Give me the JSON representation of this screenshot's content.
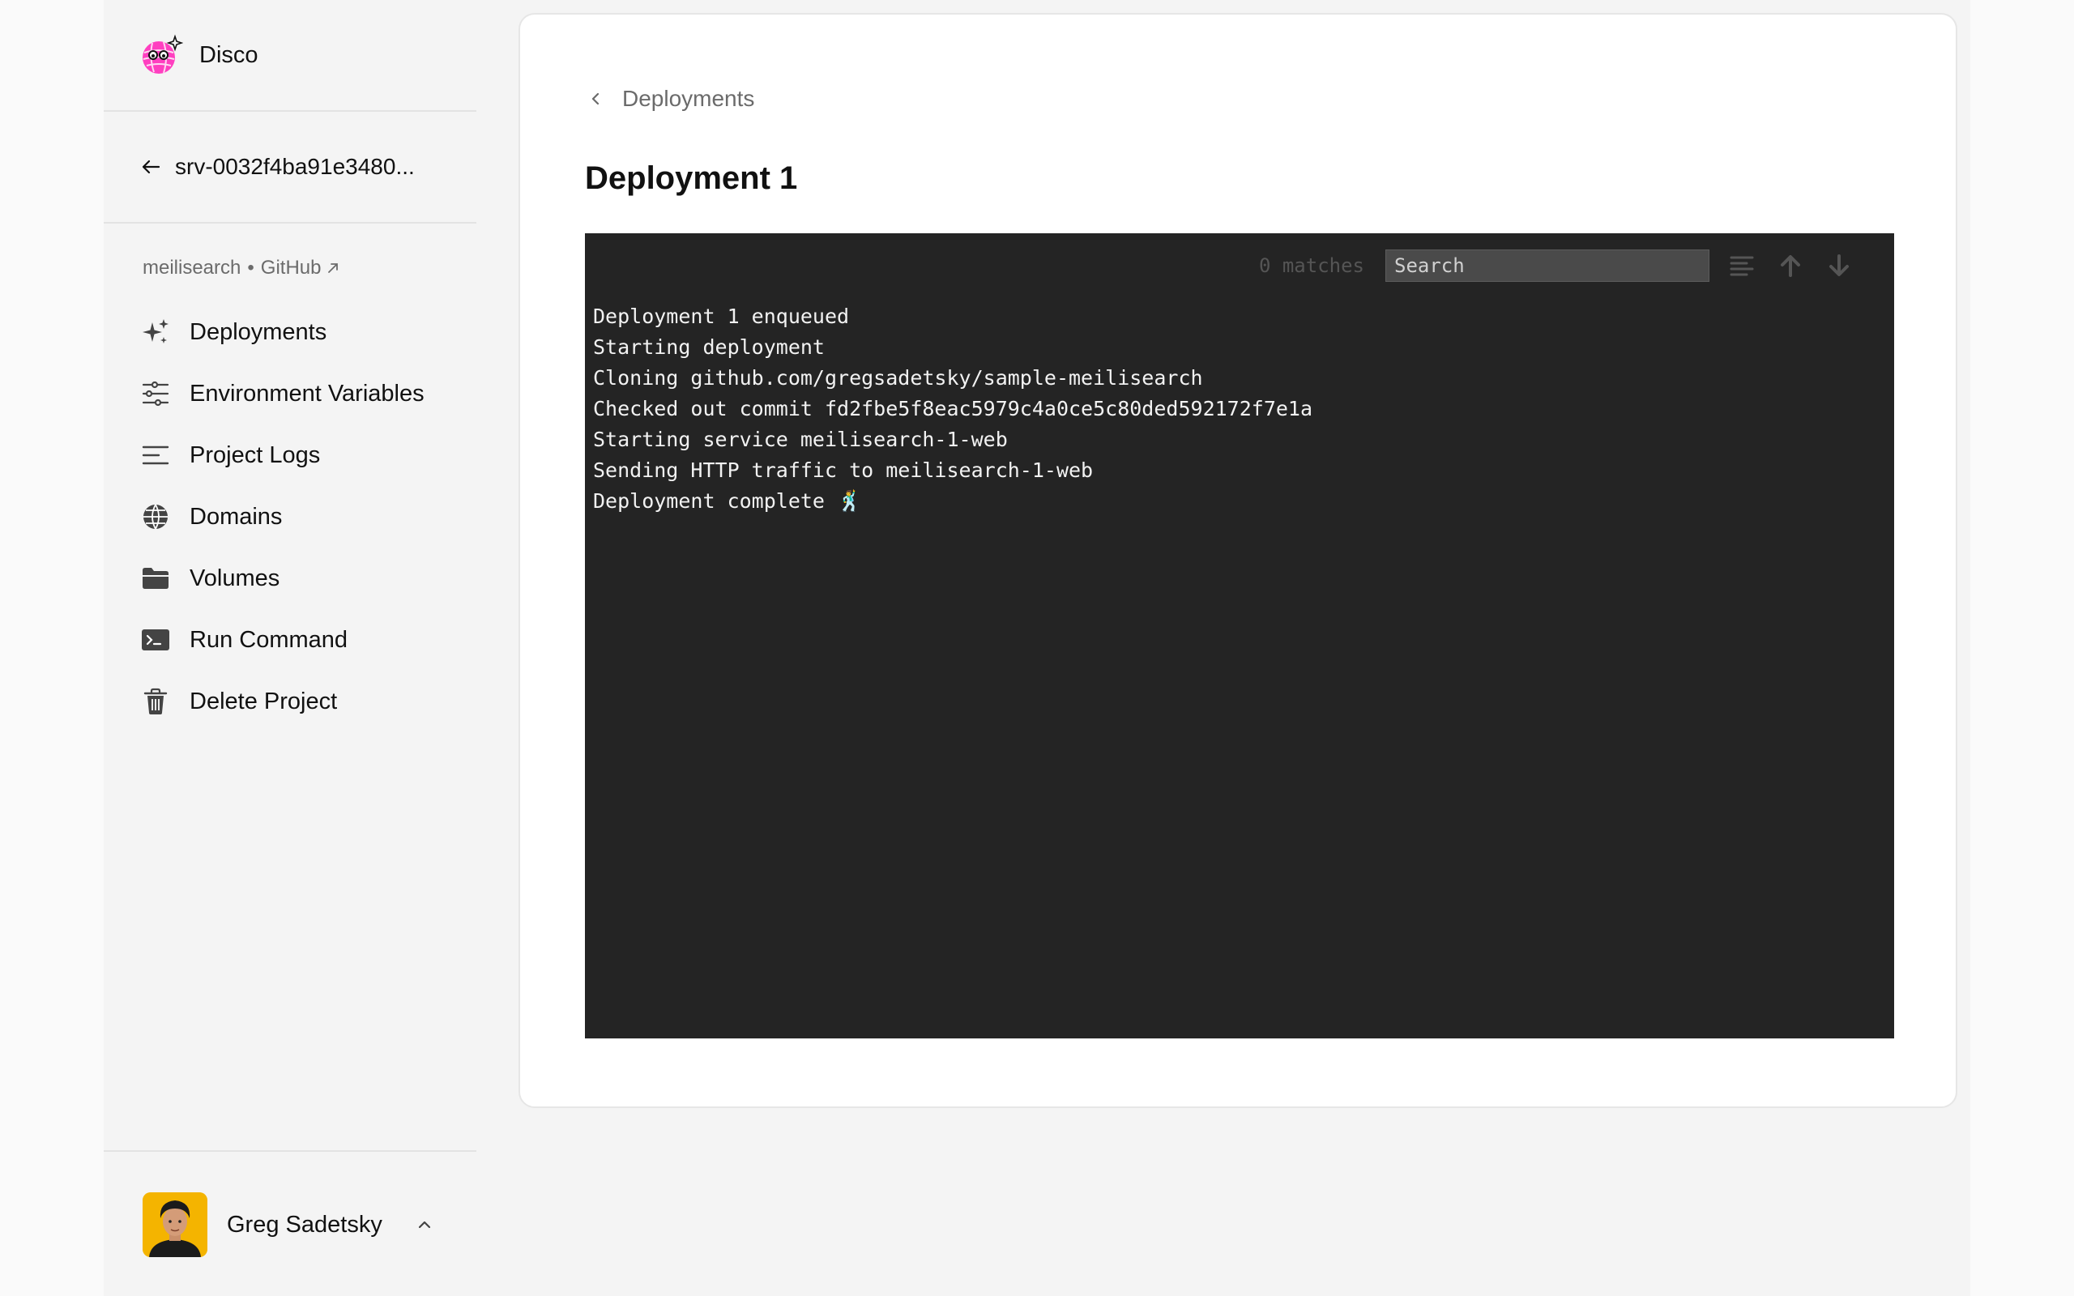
{
  "brand": {
    "name": "Disco",
    "logo_icon": "disco-ball-icon"
  },
  "sidebar": {
    "back_label": "srv-0032f4ba91e3480...",
    "project_name": "meilisearch",
    "separator": "•",
    "source_label": "GitHub",
    "items": [
      {
        "label": "Deployments",
        "icon": "sparkles-icon"
      },
      {
        "label": "Environment Variables",
        "icon": "sliders-icon"
      },
      {
        "label": "Project Logs",
        "icon": "lines-icon"
      },
      {
        "label": "Domains",
        "icon": "globe-icon"
      },
      {
        "label": "Volumes",
        "icon": "folder-icon"
      },
      {
        "label": "Run Command",
        "icon": "terminal-icon"
      },
      {
        "label": "Delete Project",
        "icon": "trash-icon"
      }
    ],
    "user": {
      "name": "Greg Sadetsky"
    }
  },
  "main": {
    "breadcrumb": "Deployments",
    "title": "Deployment 1",
    "terminal": {
      "matches": "0 matches",
      "search_placeholder": "Search",
      "lines": [
        "Deployment 1 enqueued",
        "Starting deployment",
        "Cloning github.com/gregsadetsky/sample-meilisearch",
        "Checked out commit fd2fbe5f8eac5979c4a0ce5c80ded592172f7e1a",
        "Starting service meilisearch-1-web",
        "Sending HTTP traffic to meilisearch-1-web",
        "Deployment complete 🕺"
      ]
    }
  },
  "colors": {
    "terminal_bg": "#242424",
    "page_bg": "#f4f4f4",
    "brand_pink": "#ff3fc0",
    "avatar_bg": "#f4b400"
  }
}
